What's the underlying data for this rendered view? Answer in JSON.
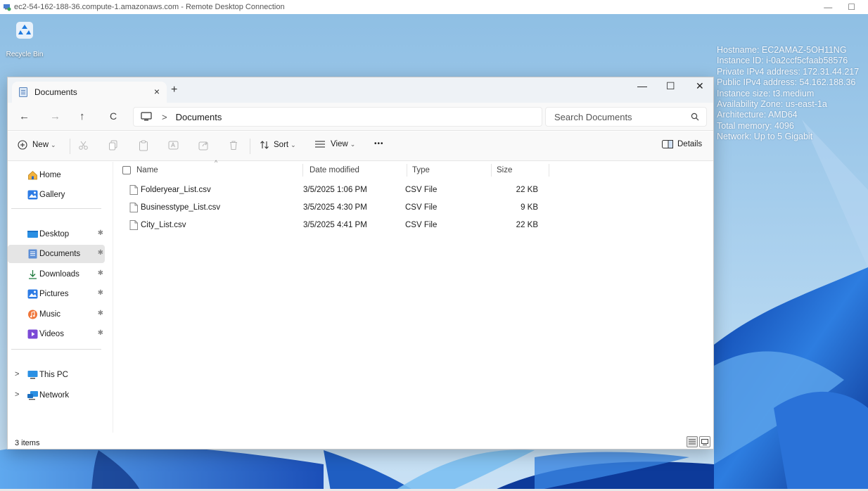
{
  "rdp": {
    "title": "ec2-54-162-188-36.compute-1.amazonaws.com - Remote Desktop Connection",
    "minimize_glyph": "—",
    "maximize_glyph": "☐"
  },
  "desktop": {
    "recycle_bin_label": "Recycle Bin",
    "sysinfo": {
      "hostname": "Hostname: EC2AMAZ-5OH11NG",
      "instance_id": "Instance ID: i-0a2ccf5cfaab58576",
      "private_ip": "Private IPv4 address: 172.31.44.217",
      "public_ip": "Public IPv4 address: 54.162.188.36",
      "instance_size": "Instance size: t3.medium",
      "az": "Availability Zone: us-east-1a",
      "arch": "Architecture: AMD64",
      "memory": "Total memory: 4096",
      "network": "Network: Up to 5 Gigabit"
    }
  },
  "explorer": {
    "tab": {
      "label": "Documents",
      "close_glyph": "×"
    },
    "new_tab_glyph": "+",
    "window_controls": {
      "minimize": "—",
      "maximize": "☐",
      "close": "✕"
    },
    "nav": {
      "back": "←",
      "forward": "→",
      "up": "↑",
      "refresh": "C",
      "breadcrumb_sep": ">",
      "breadcrumb": "Documents"
    },
    "search": {
      "placeholder": "Search Documents"
    },
    "toolbar": {
      "new_label": "New",
      "sort_label": "Sort",
      "view_label": "View",
      "more_glyph": "•••",
      "details_label": "Details",
      "caret": "⌄"
    },
    "sidebar": {
      "home": "Home",
      "gallery": "Gallery",
      "desktop": "Desktop",
      "documents": "Documents",
      "downloads": "Downloads",
      "pictures": "Pictures",
      "music": "Music",
      "videos": "Videos",
      "this_pc": "This PC",
      "network": "Network",
      "pin_glyph": "✱",
      "chevron": ">"
    },
    "columns": {
      "name": "Name",
      "date_modified": "Date modified",
      "type": "Type",
      "size": "Size",
      "sort_indicator": "^"
    },
    "files": [
      {
        "name": "Folderyear_List.csv",
        "date": "3/5/2025 1:06 PM",
        "type": "CSV File",
        "size": "22 KB"
      },
      {
        "name": "Businesstype_List.csv",
        "date": "3/5/2025 4:30 PM",
        "type": "CSV File",
        "size": "9 KB"
      },
      {
        "name": "City_List.csv",
        "date": "3/5/2025 4:41 PM",
        "type": "CSV File",
        "size": "22 KB"
      }
    ],
    "status": {
      "item_count": "3 items"
    }
  },
  "colors": {
    "accent": "#0067c0",
    "selected_row": "#e5e5e5",
    "desktop_sky": "#a5cdec",
    "bloom_blue": "#1f63c8"
  }
}
